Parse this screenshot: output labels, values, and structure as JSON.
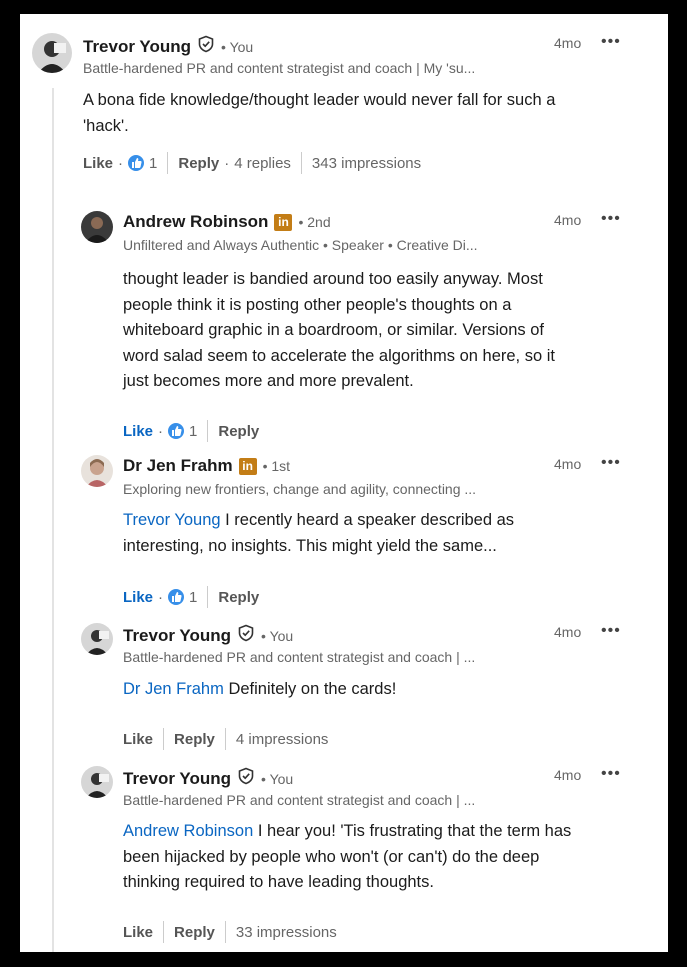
{
  "comments": [
    {
      "name": "Trevor Young",
      "badge": "verified",
      "degree": "You",
      "subtitle": "Battle-hardened PR and content strategist and coach | My 'su...",
      "time": "4mo",
      "more": "•••",
      "body": [
        "A bona fide knowledge/thought leader would never fall for such a",
        "'hack'."
      ],
      "mention": "",
      "actions": {
        "like": "Like",
        "reaction_count": "1",
        "reply": "Reply",
        "replies": "4 replies",
        "impressions": "343 impressions"
      }
    },
    {
      "name": "Andrew Robinson",
      "badge": "in",
      "degree": "2nd",
      "subtitle": "Unfiltered and Always Authentic • Speaker • Creative Di...",
      "time": "4mo",
      "more": "•••",
      "body": [
        "thought leader is bandied around too easily anyway. Most",
        "people think it is posting other people's thoughts on a",
        "whiteboard graphic in a boardroom, or similar. Versions of",
        "word salad seem to accelerate the algorithms on here, so it",
        "just becomes more and more prevalent."
      ],
      "mention": "",
      "actions": {
        "like": "Like",
        "reaction_count": "1",
        "reply": "Reply"
      }
    },
    {
      "name": "Dr Jen Frahm",
      "badge": "in",
      "degree": "1st",
      "subtitle": "Exploring new frontiers, change and agility, connecting ...",
      "time": "4mo",
      "more": "•••",
      "mention": "Trevor Young",
      "body": [
        " I recently heard a speaker described as",
        "interesting, no insights. This might yield the same..."
      ],
      "actions": {
        "like": "Like",
        "reaction_count": "1",
        "reply": "Reply"
      }
    },
    {
      "name": "Trevor Young",
      "badge": "verified",
      "degree": "You",
      "subtitle": "Battle-hardened PR and content strategist and coach | ...",
      "time": "4mo",
      "more": "•••",
      "mention": "Dr Jen Frahm",
      "body": [
        " Definitely on the cards!"
      ],
      "actions": {
        "like": "Like",
        "reply": "Reply",
        "impressions": "4 impressions"
      }
    },
    {
      "name": "Trevor Young",
      "badge": "verified",
      "degree": "You",
      "subtitle": "Battle-hardened PR and content strategist and coach | ...",
      "time": "4mo",
      "more": "•••",
      "mention": "Andrew Robinson",
      "body": [
        " I hear you! 'Tis frustrating that the term has",
        "been hijacked by people who won't (or can't) do the deep",
        "thinking required to have leading thoughts."
      ],
      "actions": {
        "like": "Like",
        "reply": "Reply",
        "impressions": "33 impressions"
      }
    }
  ],
  "colors": {
    "link": "#0a66c2",
    "reaction": "#378fe9",
    "linkedin_badge": "#c37d16"
  }
}
